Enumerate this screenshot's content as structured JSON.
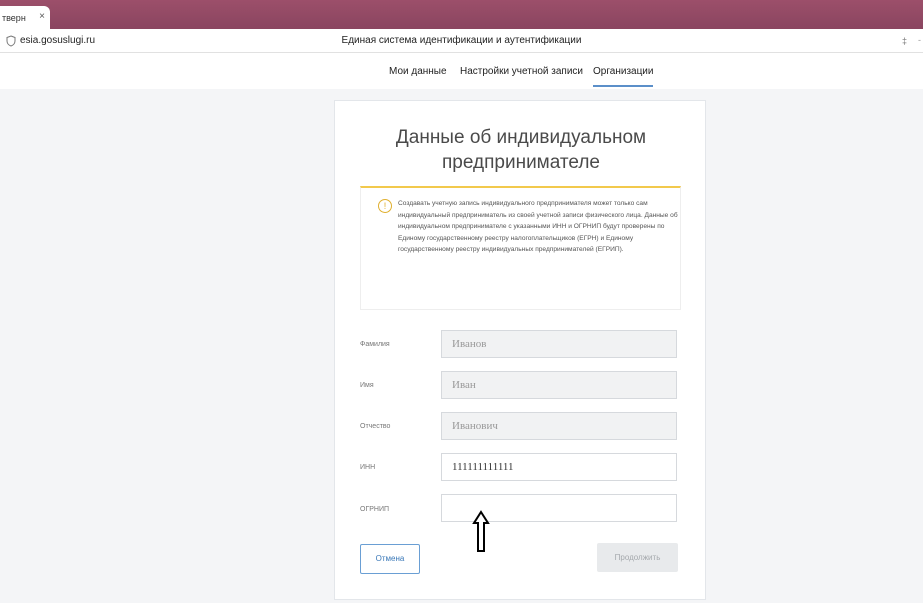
{
  "browser": {
    "tab_label": "тверн",
    "tab_close": "×",
    "url": "esia.gosuslugi.ru",
    "page_title": "Единая система идентификации и аутентификации",
    "ext_label": "‡",
    "ext_more": "-"
  },
  "nav": {
    "items": [
      "Мои данные",
      "Настройки учетной записи",
      "Организации"
    ],
    "active": "Организации"
  },
  "form": {
    "title": "Данные об индивидуальном предпринимателе",
    "notice_text": "Создавать учетную запись индивидуального предпринимателя может только сам индивидуальный предприниматель из своей учетной записи физического лица. Данные об индивидуальном предпринимателе с указанными ИНН и ОГРНИП будут проверены по Единому государственному реестру налогоплательщиков (ЕГРН) и Единому государственному реестру индивидуальных предпринимателей (ЕГРИП).",
    "notice_icon": "!",
    "fields": [
      {
        "label": "Фамилия",
        "value": "Иванов"
      },
      {
        "label": "Имя",
        "value": "Иван"
      },
      {
        "label": "Отчество",
        "value": "Иванович"
      },
      {
        "label": "ИНН",
        "value": "111111111111"
      },
      {
        "label": "ОГРНИП",
        "value": ""
      }
    ],
    "cancel_label": "Отмена",
    "next_label": "Продолжить"
  },
  "colors": {
    "accent": "#5b8fc9",
    "warning": "#f2c94c",
    "tabbar": "#9c4f6a"
  }
}
